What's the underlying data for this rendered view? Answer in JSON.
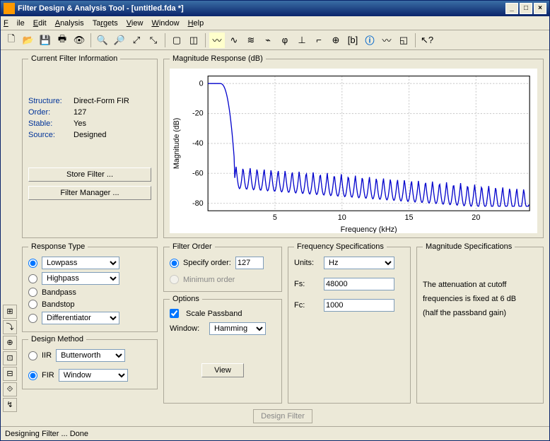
{
  "window": {
    "title": "Filter Design & Analysis Tool -  [untitled.fda *]",
    "minimize": "_",
    "maximize": "□",
    "close": "×"
  },
  "menu": {
    "file": "File",
    "edit": "Edit",
    "analysis": "Analysis",
    "targets": "Targets",
    "view": "View",
    "window": "Window",
    "help": "Help"
  },
  "info": {
    "legend": "Current Filter Information",
    "structure_k": "Structure:",
    "structure_v": "Direct-Form FIR",
    "order_k": "Order:",
    "order_v": "127",
    "stable_k": "Stable:",
    "stable_v": "Yes",
    "source_k": "Source:",
    "source_v": "Designed",
    "store_btn": "Store Filter ...",
    "manager_btn": "Filter Manager ..."
  },
  "chart": {
    "legend": "Magnitude Response (dB)",
    "ylabel": "Magnitude (dB)",
    "xlabel": "Frequency (kHz)"
  },
  "chart_data": {
    "type": "line",
    "xlabel": "Frequency (kHz)",
    "ylabel": "Magnitude (dB)",
    "xlim": [
      0,
      24
    ],
    "ylim": [
      -85,
      5
    ],
    "xticks": [
      5,
      10,
      15,
      20
    ],
    "yticks": [
      0,
      -20,
      -40,
      -60,
      -80
    ],
    "description": "FIR lowpass (Hamming window), Fs=48000 Hz, Fc=1000 Hz, order 127. Flat 0 dB passband to ~1 kHz, steep rolloff with sidelobes starting near -55 dB and decaying toward -80 dB at higher frequencies.",
    "series": [
      {
        "name": "Magnitude",
        "passband_0dB_to_kHz": 1.0,
        "transition_break": [
          1.0,
          2.0
        ],
        "sidelobe_peaks_dB_range": [
          -55,
          -70
        ],
        "stopband_floor_dB": -80
      }
    ]
  },
  "response": {
    "legend": "Response Type",
    "lowpass": "Lowpass",
    "highpass": "Highpass",
    "bandpass": "Bandpass",
    "bandstop": "Bandstop",
    "diff": "Differentiator",
    "design_legend": "Design Method",
    "iir": "IIR",
    "iir_sel": "Butterworth",
    "fir": "FIR",
    "fir_sel": "Window"
  },
  "order": {
    "legend": "Filter Order",
    "specify": "Specify order:",
    "specify_val": "127",
    "minimum": "Minimum order",
    "options_legend": "Options",
    "scale": "Scale Passband",
    "window_lbl": "Window:",
    "window_sel": "Hamming",
    "view_btn": "View"
  },
  "freq": {
    "legend": "Frequency Specifications",
    "units": "Units:",
    "units_sel": "Hz",
    "fs": "Fs:",
    "fs_val": "48000",
    "fc": "Fc:",
    "fc_val": "1000"
  },
  "mag": {
    "legend": "Magnitude Specifications",
    "text1": "The attenuation at cutoff",
    "text2": "frequencies is fixed at 6 dB",
    "text3": "(half the passband gain)"
  },
  "design_btn": "Design Filter",
  "status": "Designing Filter ... Done"
}
